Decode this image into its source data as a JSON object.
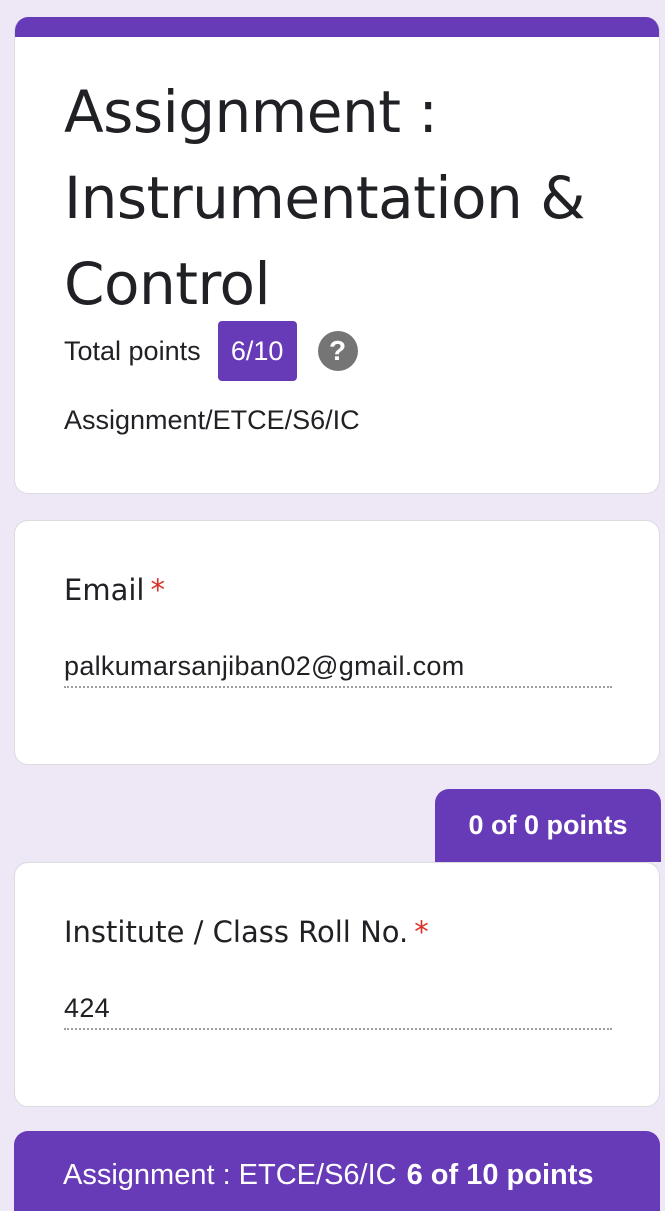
{
  "form": {
    "title": "Assignment : Instrumentation & Control",
    "total_points_label": "Total points",
    "score": "6/10",
    "help_icon": "help-circle-icon",
    "description": "Assignment/ETCE/S6/IC"
  },
  "questions": [
    {
      "title": "Email",
      "required_marker": "*",
      "answer": "palkumarsanjiban02@gmail.com"
    },
    {
      "points": "0 of 0 points",
      "title": "Institute / Class Roll No.",
      "required_marker": "*",
      "answer": "424"
    }
  ],
  "section": {
    "title": "Assignment : ETCE/S6/IC",
    "points": "6 of 10 points"
  },
  "colors": {
    "accent": "#673ab7",
    "background": "#ede7f6",
    "required": "#d93025"
  }
}
